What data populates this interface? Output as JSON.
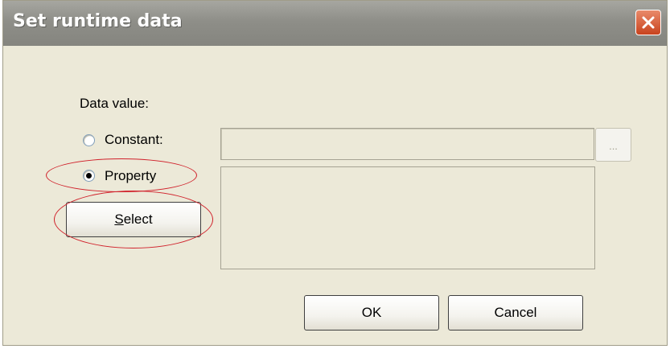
{
  "dialog": {
    "title": "Set runtime data",
    "close_icon": "close-icon"
  },
  "form": {
    "data_value_label": "Data value:",
    "constant_label": "Constant:",
    "property_label": "Property",
    "constant_value": "",
    "ellipsis_label": "...",
    "selected_option": "Property"
  },
  "buttons": {
    "select_prefix": "S",
    "select_rest": "elect",
    "ok": "OK",
    "cancel": "Cancel"
  },
  "colors": {
    "annotation": "#d0202a",
    "dialog_bg": "#ece9d8",
    "titlebar": "#8e8e88"
  }
}
